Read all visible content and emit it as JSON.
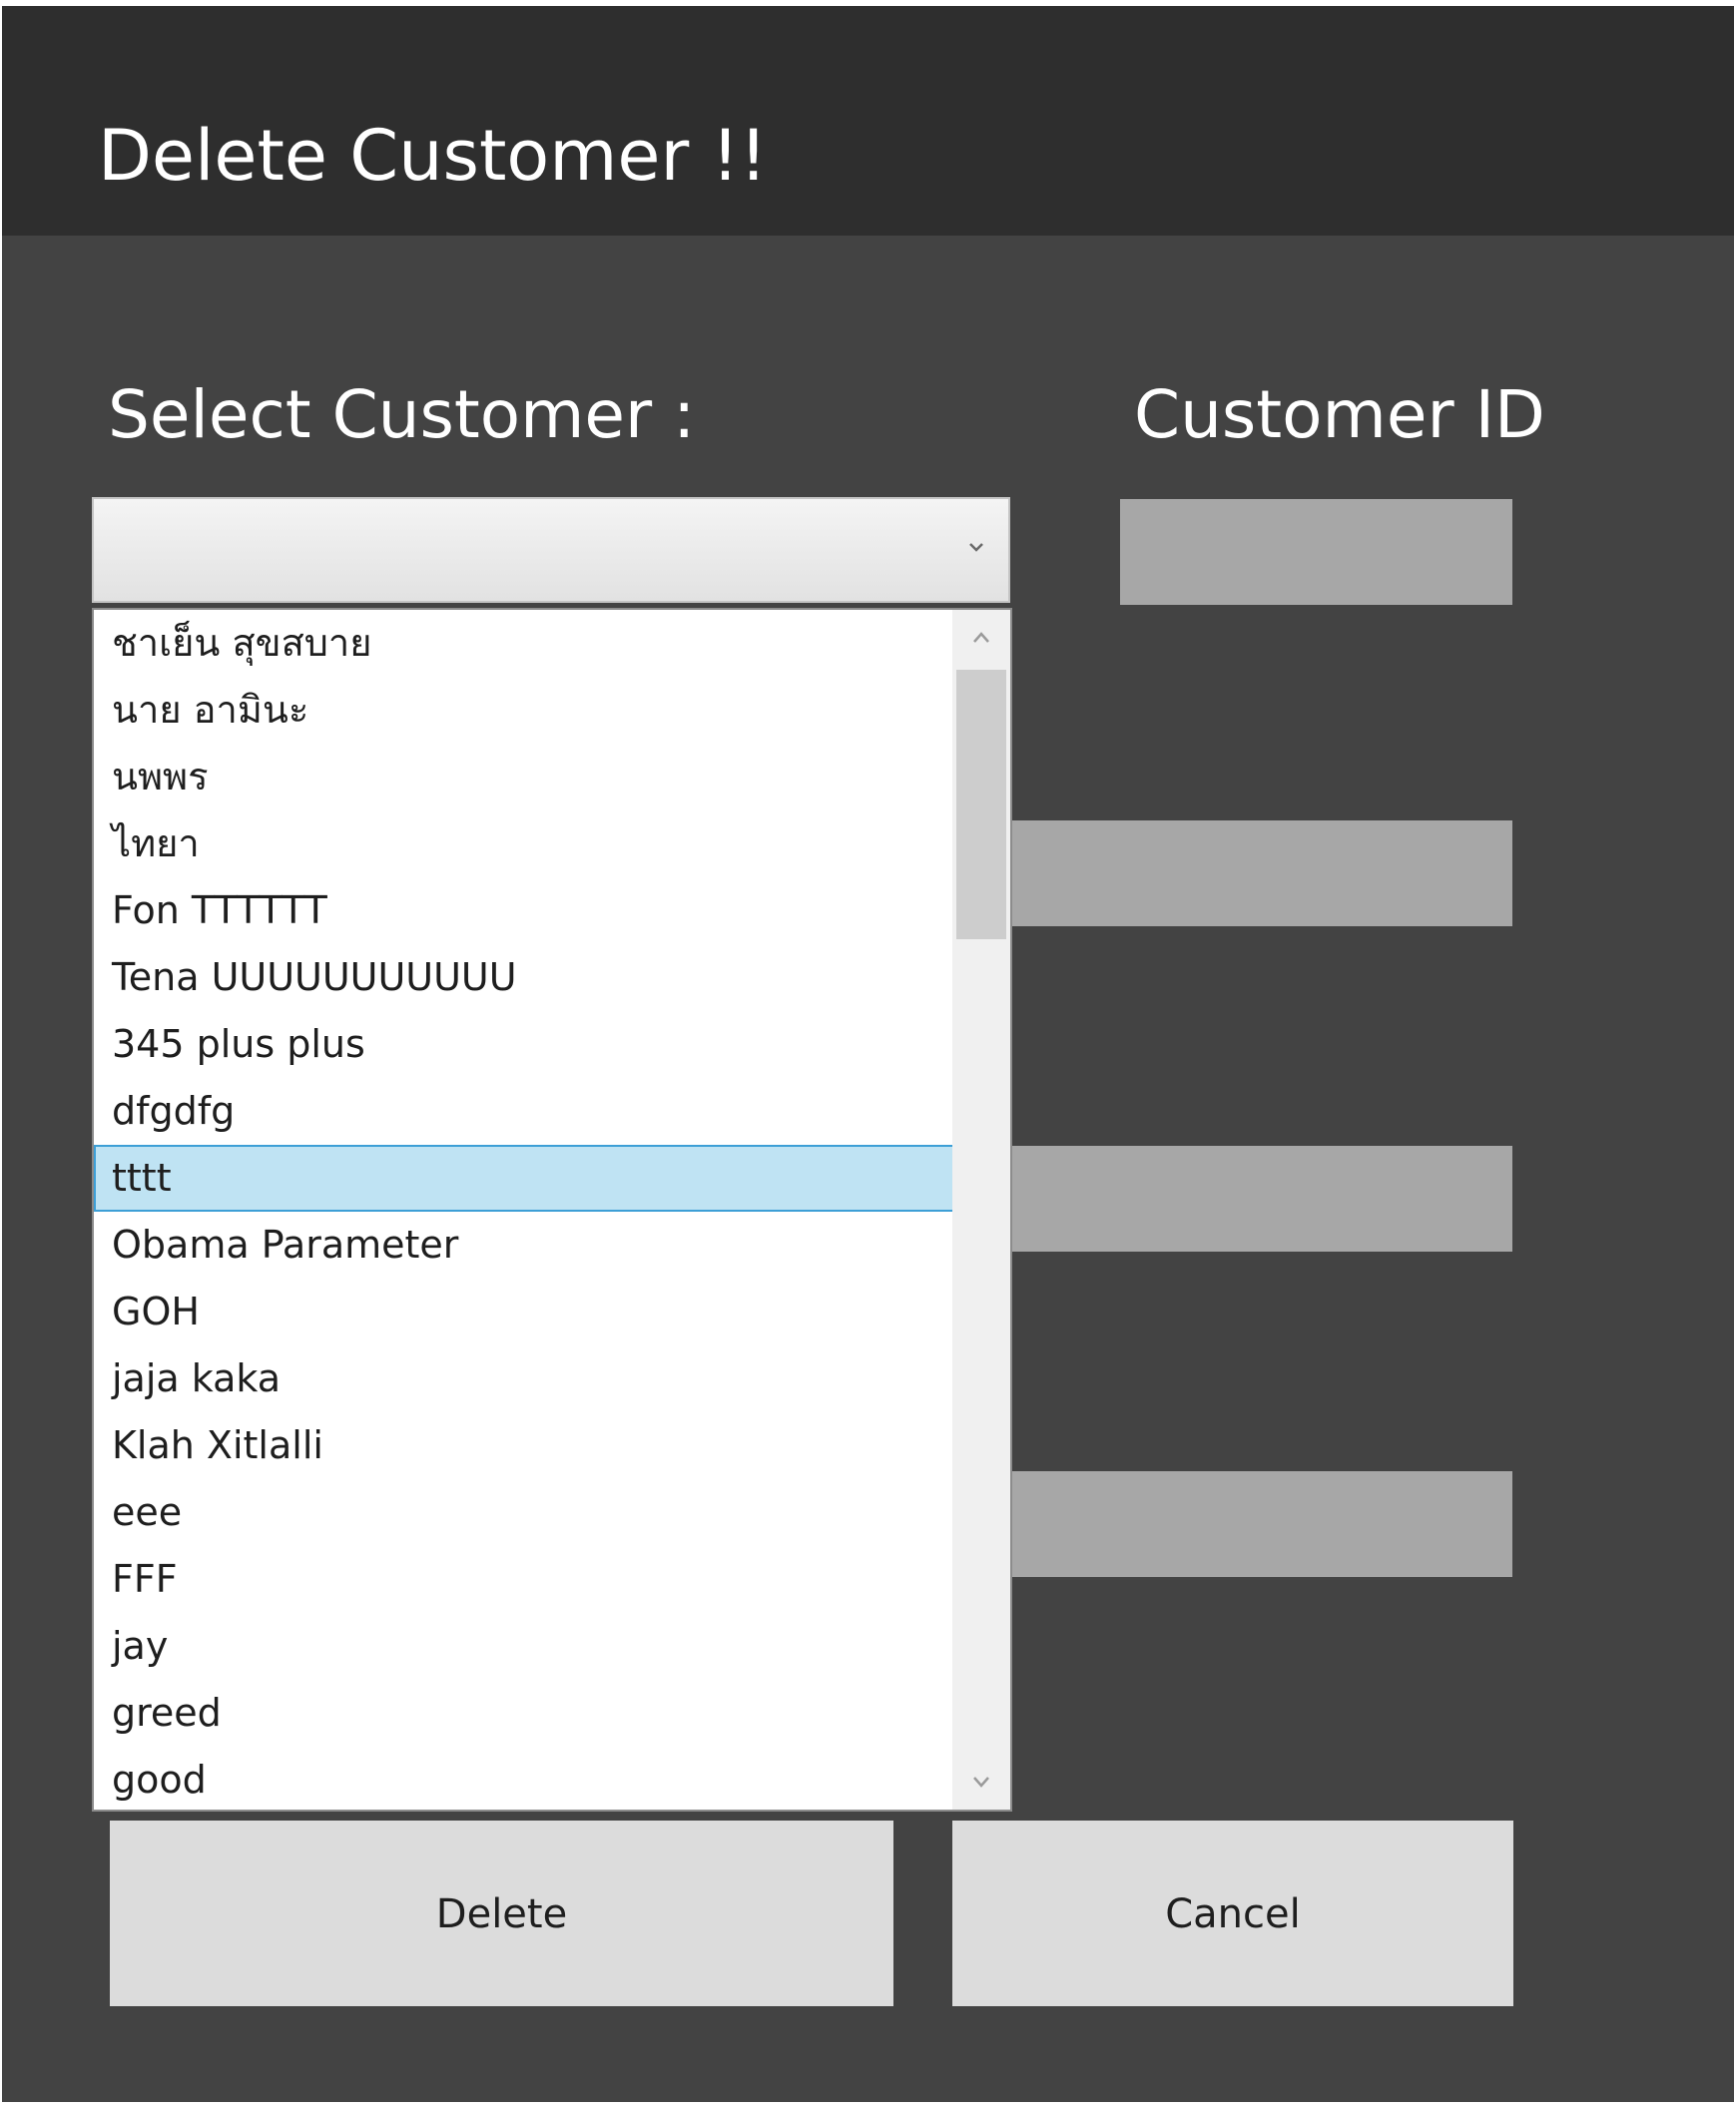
{
  "header": {
    "title": "Delete Customer !!"
  },
  "form": {
    "select_label": "Select Customer :",
    "id_label": "Customer ID",
    "selected_value": ""
  },
  "dropdown": {
    "items": [
      "ชาเย็น สุขสบาย",
      "นาย อามินะ",
      "นพพร",
      "ไทยา",
      "Fon TTTTTT",
      "Tena UUUUUUUUUUU",
      "345 plus plus",
      "dfgdfg",
      "tttt",
      "Obama Parameter",
      "GOH",
      "jaja kaka",
      "Klah Xitlalli",
      "eee",
      "FFF",
      "jay",
      "greed",
      "good"
    ],
    "highlighted_item": "tttt"
  },
  "buttons": {
    "delete_label": "Delete",
    "cancel_label": "Cancel"
  }
}
